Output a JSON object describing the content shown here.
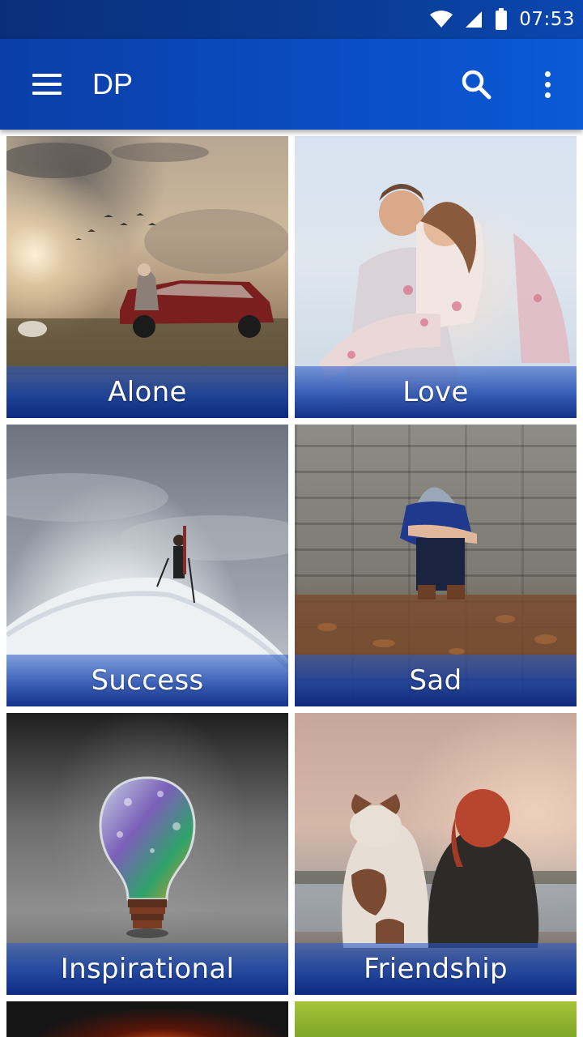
{
  "status_bar": {
    "time": "07:53",
    "icons": [
      "wifi-icon",
      "cell-signal-icon",
      "battery-icon"
    ]
  },
  "app_bar": {
    "title": "DP",
    "icons": [
      "menu-icon",
      "search-icon",
      "more-vert-icon"
    ]
  },
  "categories": [
    {
      "label": "Alone"
    },
    {
      "label": "Love"
    },
    {
      "label": "Success"
    },
    {
      "label": "Sad"
    },
    {
      "label": "Inspirational"
    },
    {
      "label": "Friendship"
    }
  ],
  "colors": {
    "status_bar": "#0a3a91",
    "app_bar": "#0b4cc2",
    "label_band": "#1441aa",
    "label_text": "#ffffff"
  }
}
